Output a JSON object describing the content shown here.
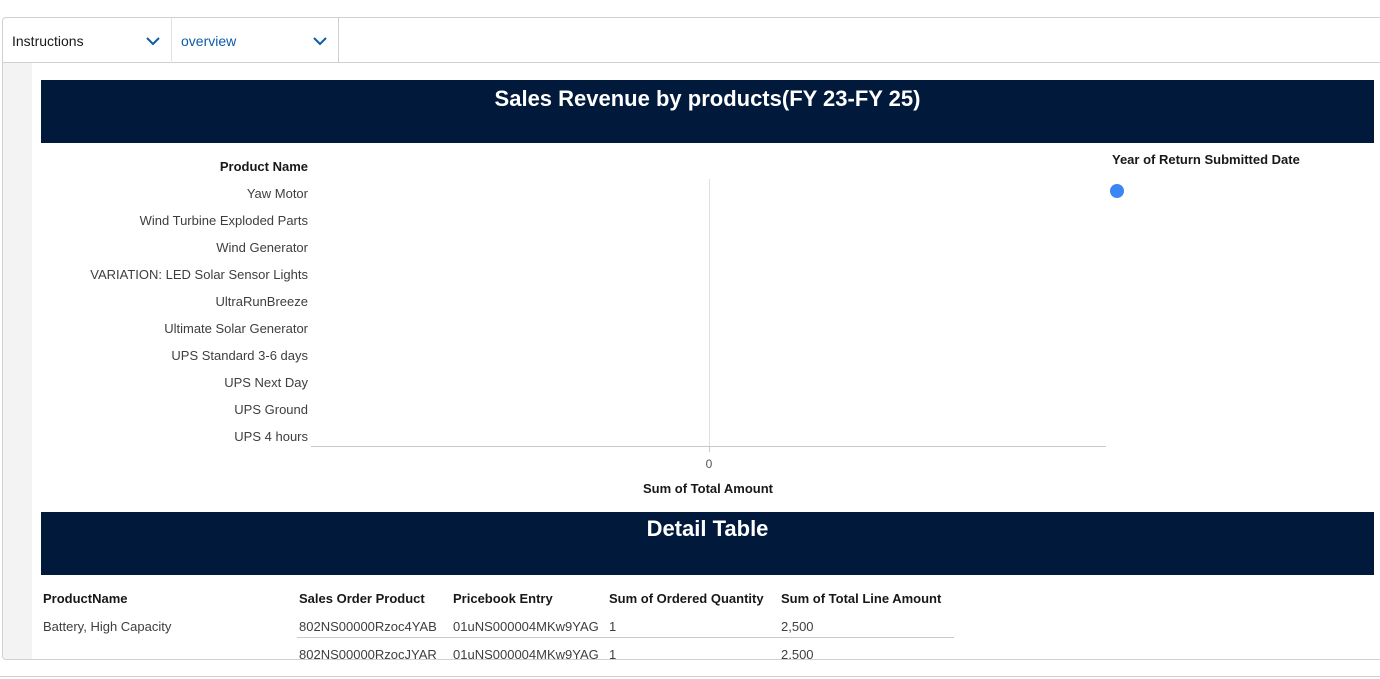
{
  "tabs": [
    {
      "label": "Instructions"
    },
    {
      "label": "overview"
    }
  ],
  "chart": {
    "banner_title": "Sales Revenue by products(FY 23-FY 25)",
    "y_header": "Product Name",
    "legend_title": "Year of Return Submitted Date",
    "legend_color": "#3b85f5"
  },
  "chart_data": {
    "type": "bar",
    "orientation": "horizontal",
    "title": "Sales Revenue by products(FY 23-FY 25)",
    "ylabel": "Product Name",
    "xlabel": "Sum of Total Amount",
    "categories": [
      "Yaw Motor",
      "Wind Turbine Exploded Parts",
      "Wind Generator",
      "VARIATION: LED Solar Sensor Lights",
      "UltraRunBreeze",
      "Ultimate Solar Generator",
      "UPS Standard 3-6 days",
      "UPS Next Day",
      "UPS Ground",
      "UPS 4 hours"
    ],
    "values": [
      0,
      0,
      0,
      0,
      0,
      0,
      0,
      0,
      0,
      0
    ],
    "x_ticks": [
      "0"
    ],
    "legend_title": "Year of Return Submitted Date",
    "grid": false,
    "legend_position": "right"
  },
  "detail": {
    "banner_title": "Detail Table",
    "columns": [
      "ProductName",
      "Sales Order Product",
      "Pricebook Entry",
      "Sum of Ordered Quantity",
      "Sum of Total Line Amount"
    ],
    "rows": [
      [
        "Battery, High Capacity",
        "802NS00000Rzoc4YAB",
        "01uNS000004MKw9YAG",
        "1",
        "2,500"
      ],
      [
        "",
        "802NS00000RzocJYAR",
        "01uNS000004MKw9YAG",
        "1",
        "2,500"
      ]
    ]
  }
}
